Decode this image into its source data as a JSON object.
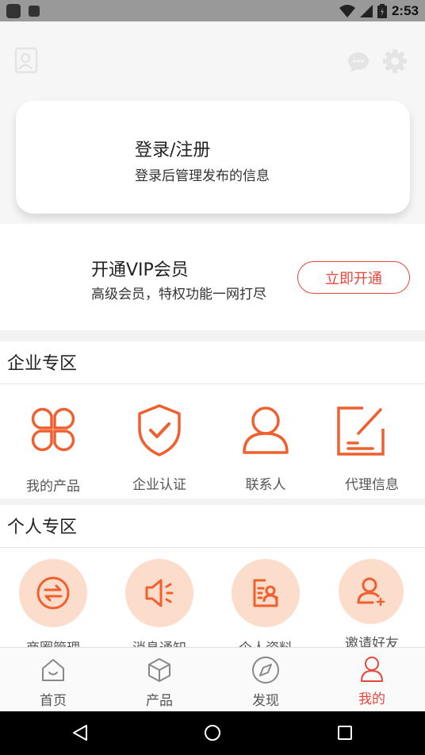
{
  "status_bar": {
    "time": "2:53"
  },
  "login_card": {
    "title": "登录/注册",
    "subtitle": "登录后管理发布的信息"
  },
  "vip": {
    "title": "开通VIP会员",
    "subtitle": "高级会员，特权功能一网打尽",
    "button_label": "立即开通"
  },
  "enterprise": {
    "title": "企业专区",
    "items": [
      {
        "label": "我的产品",
        "icon": "clover-icon"
      },
      {
        "label": "企业认证",
        "icon": "shield-check-icon"
      },
      {
        "label": "联系人",
        "icon": "person-icon"
      },
      {
        "label": "代理信息",
        "icon": "edit-note-icon"
      }
    ]
  },
  "personal": {
    "title": "个人专区",
    "items": [
      {
        "label": "商圈管理",
        "icon": "exchange-icon"
      },
      {
        "label": "消息通知",
        "icon": "speaker-icon"
      },
      {
        "label": "个人资料",
        "icon": "profile-card-icon"
      },
      {
        "label": "邀请好友",
        "icon": "add-user-icon"
      }
    ]
  },
  "tabbar": {
    "tabs": [
      {
        "label": "首页",
        "icon": "home-icon"
      },
      {
        "label": "产品",
        "icon": "cube-icon"
      },
      {
        "label": "发现",
        "icon": "compass-icon"
      },
      {
        "label": "我的",
        "icon": "user-icon",
        "active": true
      }
    ]
  },
  "colors": {
    "accent": "#e8463b",
    "icon_orange": "#f0602e",
    "circle_bg": "#fcdcca"
  }
}
